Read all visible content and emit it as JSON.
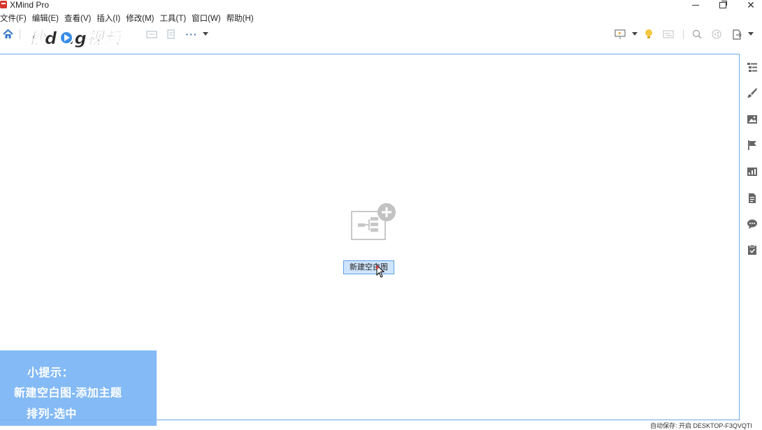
{
  "window": {
    "title": "XMind Pro"
  },
  "menu": {
    "items": [
      "文件(F)",
      "编辑(E)",
      "查看(V)",
      "插入(I)",
      "修改(M)",
      "工具(T)",
      "窗口(W)",
      "帮助(H)"
    ]
  },
  "toolbar": {
    "brand_logo_text": "秒懂视频"
  },
  "canvas": {
    "new_map_button": "新建空白图"
  },
  "tip": {
    "title": "小提示：",
    "line1": "新建空白图-添加主题",
    "line2": "排列-选中"
  },
  "status": {
    "text": "自动保存: 开启    DESKTOP-F3QVQTI"
  },
  "colors": {
    "accent": "#6aa9e8",
    "tip_bg": "#7fb8f5",
    "button_bg": "#cfe4fb",
    "app_logo": "#d6362c"
  },
  "icons": {
    "side_panel": [
      "outline-icon",
      "format-brush-icon",
      "image-icon",
      "marker-flag-icon",
      "chart-icon",
      "notes-icon",
      "comment-icon",
      "task-icon"
    ]
  }
}
